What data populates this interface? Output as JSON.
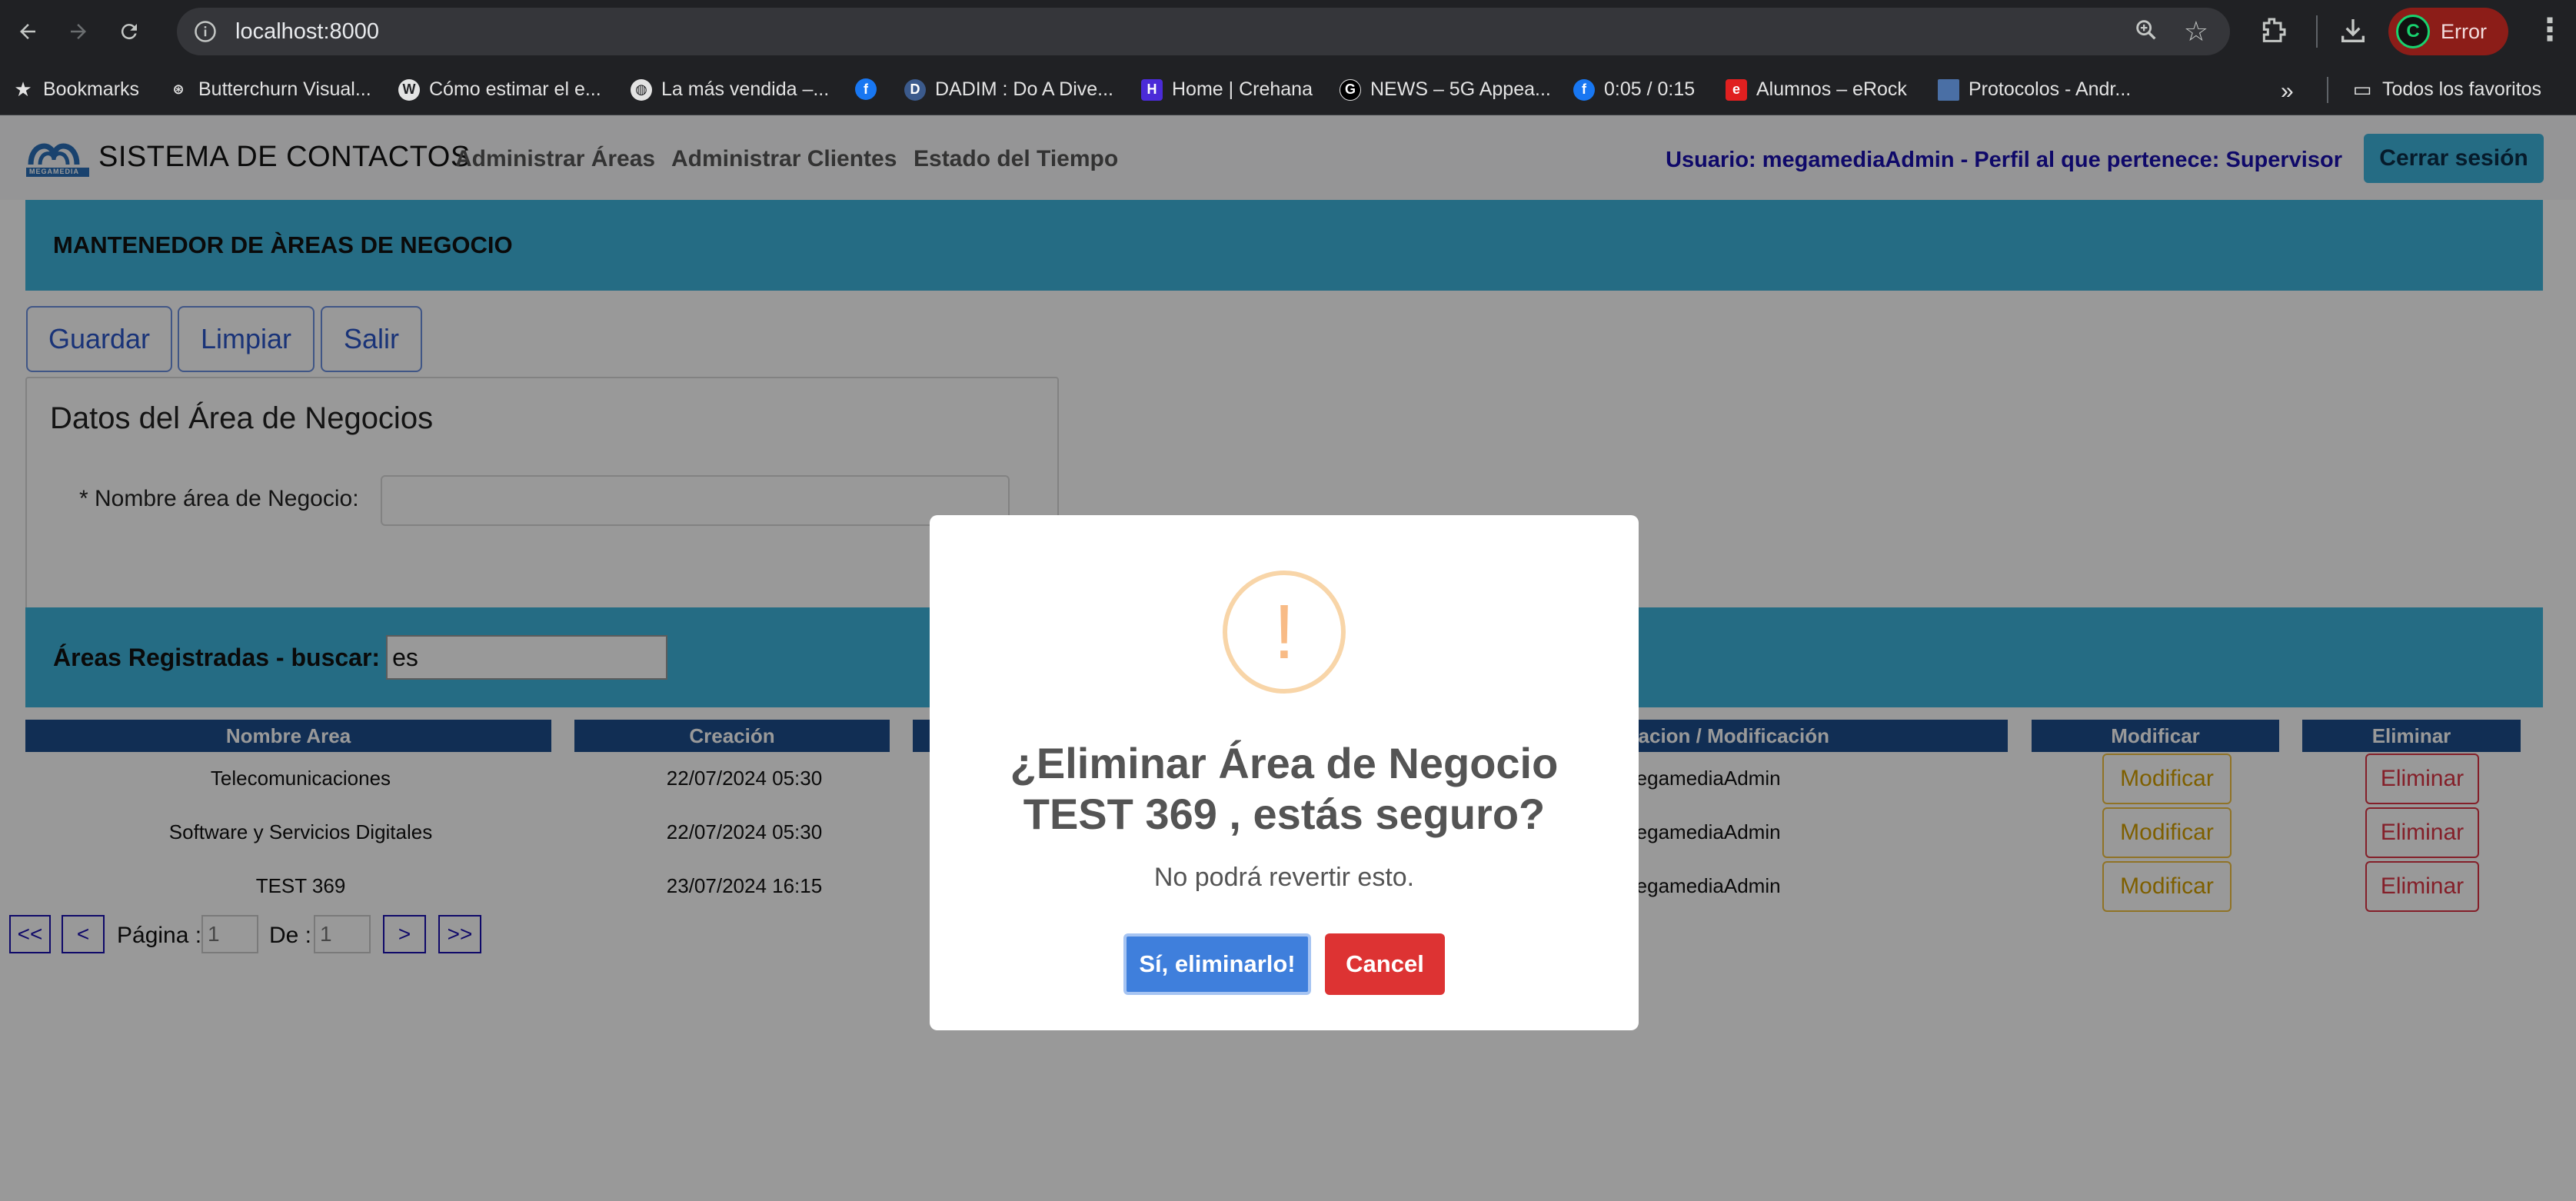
{
  "browser": {
    "url": "localhost:8000",
    "profile_status": "Error",
    "bookmarks": [
      {
        "label": "Bookmarks"
      },
      {
        "label": "Butterchurn Visual..."
      },
      {
        "label": "Cómo estimar el e..."
      },
      {
        "label": "La más vendida –..."
      },
      {
        "label": ""
      },
      {
        "label": "DADIM : Do A Dive..."
      },
      {
        "label": "Home | Crehana"
      },
      {
        "label": "NEWS – 5G Appea..."
      },
      {
        "label": "0:05 / 0:15"
      },
      {
        "label": "Alumnos – eRock"
      },
      {
        "label": "Protocolos - Andr..."
      }
    ],
    "all_bookmarks": "Todos los favoritos",
    "overflow": "»"
  },
  "app": {
    "brand_name": "SISTEMA DE CONTACTOS",
    "logo_caption": "MEGAMEDIA",
    "nav": [
      "Administrar Áreas",
      "Administrar Clientes",
      "Estado del Tiempo"
    ],
    "user_info": "Usuario: megamediaAdmin - Perfil al que pertenece: Supervisor",
    "logout": "Cerrar sesión"
  },
  "page": {
    "title": "MANTENEDOR DE ÀREAS DE NEGOCIO",
    "actions": {
      "save": "Guardar",
      "clear": "Limpiar",
      "exit": "Salir"
    },
    "form": {
      "title": "Datos del Área de Negocios",
      "name_label": "* Nombre área de Negocio:",
      "name_value": ""
    },
    "search": {
      "label": "Áreas Registradas - buscar:",
      "value": "es"
    },
    "table": {
      "headers": {
        "name": "Nombre Area",
        "created": "Creación",
        "user": "Usuario Creacion / Modificación",
        "modify": "Modificar",
        "delete": "Eliminar"
      },
      "rows": [
        {
          "name": "Telecomunicaciones",
          "created": "22/07/2024 05:30",
          "user": "megamediaAdmin",
          "modify": "Modificar",
          "delete": "Eliminar"
        },
        {
          "name": "Software y Servicios Digitales",
          "created": "22/07/2024 05:30",
          "user": "megamediaAdmin",
          "modify": "Modificar",
          "delete": "Eliminar"
        },
        {
          "name": "TEST 369",
          "created": "23/07/2024 16:15",
          "user": "megamediaAdmin",
          "modify": "Modificar",
          "delete": "Eliminar"
        }
      ]
    },
    "pager": {
      "first": "<<",
      "prev": "<",
      "next": ">",
      "last": ">>",
      "page_label": "Página :",
      "page_value": "1",
      "of_label": "De :",
      "of_value": "1"
    }
  },
  "modal": {
    "icon": "warning-icon",
    "title_line1": "¿Eliminar Área de Negocio",
    "title_line2": "TEST 369 , estás seguro?",
    "text": "No podrá revertir esto.",
    "confirm": "Sí, eliminarlo!",
    "cancel": "Cancel"
  },
  "colors": {
    "header_bar": "#3fb4dc",
    "table_header": "#1d4e8c",
    "confirm": "#3f7fdc",
    "cancel": "#dd3333"
  }
}
